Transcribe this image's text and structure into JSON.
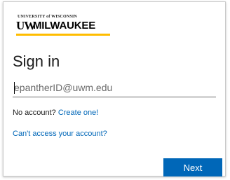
{
  "logo": {
    "university_text": "UNIVERSITY of WISCONSIN",
    "uw_text": "UW",
    "milwaukee_text": "MILWAUKEE",
    "accent_color": "#ffbd00"
  },
  "signin": {
    "title": "Sign in",
    "input_placeholder": "epantherID@uwm.edu",
    "input_value": "",
    "no_account_text": "No account?",
    "create_link": "Create one!",
    "cant_access_link": "Can't access your account?",
    "next_label": "Next",
    "button_color": "#0067b8"
  }
}
